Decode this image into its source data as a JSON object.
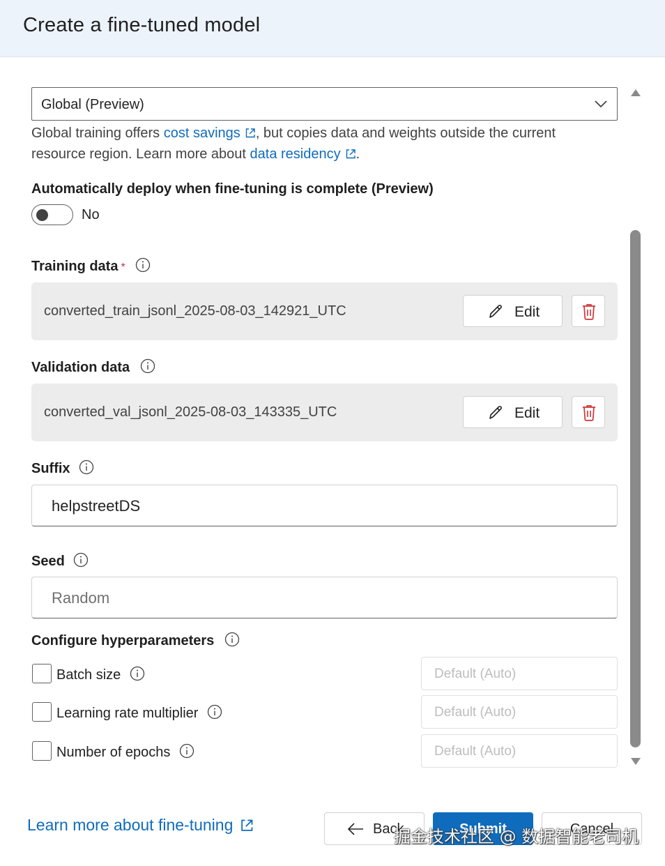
{
  "header": {
    "title": "Create a fine-tuned model"
  },
  "training_type": {
    "selected": "Global (Preview)",
    "help_prefix": "Global training offers ",
    "cost_link": "cost savings",
    "help_middle": ", but copies data and weights outside the current resource region. Learn more about ",
    "residency_link": "data residency",
    "help_suffix": "."
  },
  "auto_deploy": {
    "label": "Automatically deploy when fine-tuning is complete (Preview)",
    "state_text": "No"
  },
  "training_data": {
    "label": "Training data",
    "required_mark": "*",
    "file": "converted_train_jsonl_2025-08-03_142921_UTC",
    "edit_label": "Edit"
  },
  "validation_data": {
    "label": "Validation data",
    "file": "converted_val_jsonl_2025-08-03_143335_UTC",
    "edit_label": "Edit"
  },
  "suffix": {
    "label": "Suffix",
    "value": "helpstreetDS"
  },
  "seed": {
    "label": "Seed",
    "placeholder": "Random"
  },
  "hyperparameters": {
    "label": "Configure hyperparameters",
    "items": [
      {
        "label": "Batch size",
        "placeholder": "Default (Auto)"
      },
      {
        "label": "Learning rate multiplier",
        "placeholder": "Default (Auto)"
      },
      {
        "label": "Number of epochs",
        "placeholder": "Default (Auto)"
      }
    ]
  },
  "footer": {
    "learn_more": "Learn more about fine-tuning",
    "back_label": "Back",
    "submit_label": "Submit",
    "cancel_label": "Cancel"
  },
  "watermark": "掘金技术社区 @ 数据智能老司机",
  "colors": {
    "accent": "#0f6cbd",
    "delete": "#d13438",
    "header_bg": "#ecf3fa",
    "card_bg": "#ececec"
  },
  "icons": [
    "chevron-down-icon",
    "external-link-icon",
    "info-icon",
    "pencil-icon",
    "trash-icon",
    "arrow-left-icon"
  ]
}
